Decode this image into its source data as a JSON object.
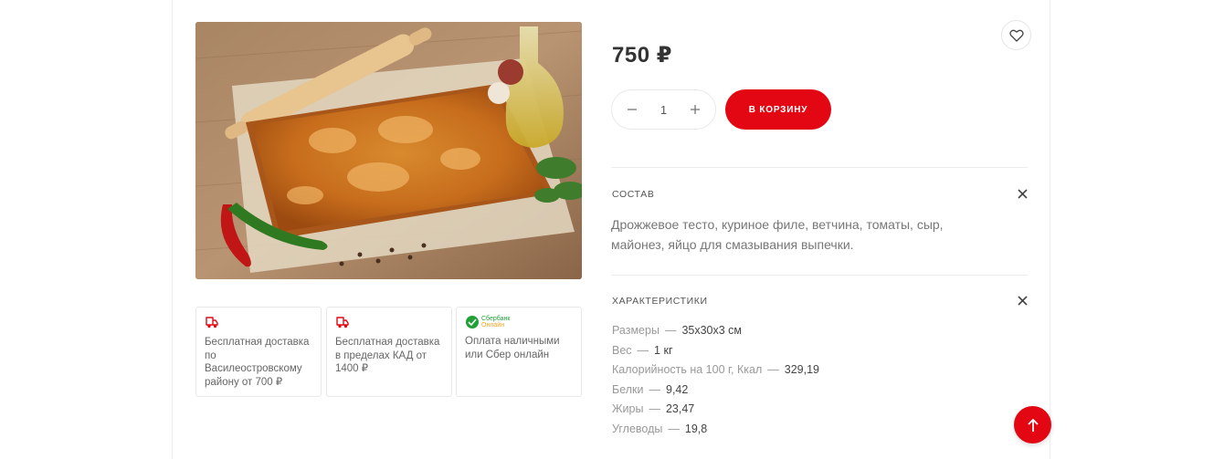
{
  "product": {
    "price": "750 ₽",
    "quantity": "1",
    "cart_button_label": "В корзину",
    "image_alt": "pie"
  },
  "info_cards": [
    {
      "icon": "delivery-truck-icon",
      "text": "Бесплатная доставка по Василеостровскому району от 700 ₽"
    },
    {
      "icon": "delivery-truck-icon",
      "text": "Бесплатная доставка в пределах КАД от 1400 ₽"
    },
    {
      "icon": "sberbank-logo-icon",
      "logo_text_1": "Сбербанк",
      "logo_text_2": "Онлайн",
      "text": "Оплата наличными или Сбер онлайн"
    }
  ],
  "composition": {
    "title": "Состав",
    "text": "Дрожжевое тесто, куриное филе, ветчина, томаты, сыр, майонез, яйцо для смазывания выпечки."
  },
  "characteristics": {
    "title": "Характеристики",
    "items": [
      {
        "name": "Размеры",
        "value": "35х30х3 см"
      },
      {
        "name": "Вес",
        "value": "1 кг"
      },
      {
        "name": "Калорийность на 100 г, Ккал",
        "value": "329,19"
      },
      {
        "name": "Белки",
        "value": "9,42"
      },
      {
        "name": "Жиры",
        "value": "23,47"
      },
      {
        "name": "Углеводы",
        "value": "19,8"
      }
    ]
  },
  "colors": {
    "accent": "#e30613",
    "sber_green": "#21a038"
  }
}
